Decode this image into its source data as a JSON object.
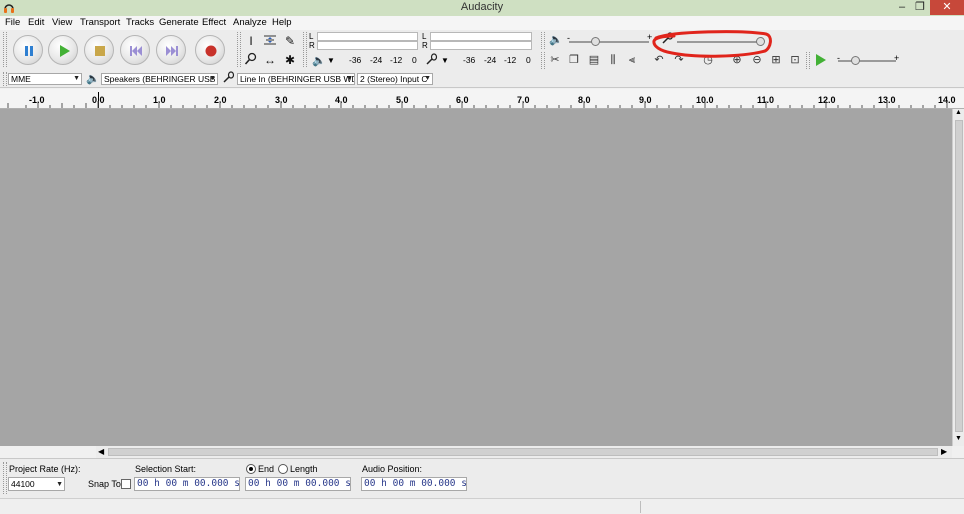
{
  "window": {
    "title": "Audacity",
    "minimize": "–",
    "maximize": "❐",
    "close": "✕"
  },
  "menu": [
    "File",
    "Edit",
    "View",
    "Transport",
    "Tracks",
    "Generate",
    "Effect",
    "Analyze",
    "Help"
  ],
  "meters": {
    "left_label": "L",
    "right_label": "R",
    "playback_scale": [
      "-36",
      "-24",
      "-12",
      "0"
    ],
    "record_scale": [
      "-36",
      "-24",
      "-12",
      "0"
    ]
  },
  "volume": {
    "minus": "-",
    "plus": "+"
  },
  "speed": {
    "minus": "-",
    "plus": "+"
  },
  "devices": {
    "host": "MME",
    "playback": "Speakers (BEHRINGER USB WI",
    "recording": "Line In (BEHRINGER USB WDM",
    "channels": "2 (Stereo) Input C"
  },
  "ruler": [
    "-1.0",
    "0.0",
    "1.0",
    "2.0",
    "3.0",
    "4.0",
    "5.0",
    "6.0",
    "7.0",
    "8.0",
    "9.0",
    "10.0",
    "11.0",
    "12.0",
    "13.0",
    "14.0"
  ],
  "bottom": {
    "project_rate_label": "Project Rate (Hz):",
    "project_rate": "44100",
    "snap_to": "Snap To",
    "selection_start_label": "Selection Start:",
    "end_label": "End",
    "length_label": "Length",
    "audio_position_label": "Audio Position:",
    "selection_start": "00 h 00 m 00.000 s",
    "selection_end": "00 h 00 m 00.000 s",
    "audio_position": "00 h 00 m 00.000 s"
  },
  "colors": {
    "annotation": "#e0241b",
    "track_bg": "#a5a5a5",
    "titlebar": "#cfe0c2",
    "close": "#c7483a"
  }
}
